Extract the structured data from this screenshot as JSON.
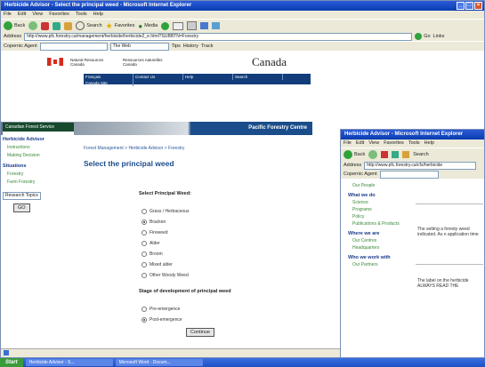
{
  "main_window": {
    "title": "Herbicide Advisor - Select the principal weed - Microsoft Internet Explorer",
    "menu": [
      "File",
      "Edit",
      "View",
      "Favorites",
      "Tools",
      "Help"
    ],
    "toolbar": {
      "back": "Back",
      "search": "Search",
      "favorites": "Favorites",
      "media": "Media"
    },
    "address_label": "Address",
    "address_url": "http://www.pfc.forestry.ca/management/herbicide/herbicide2_e.html?SUBBTN=Forestry",
    "go_label": "Go",
    "links_label": "Links",
    "copernic_label": "Copernic Agent",
    "copernic_search": "The Web",
    "copernic_buttons": [
      "Tips",
      "History",
      "Track"
    ],
    "status_text": ""
  },
  "page": {
    "gov_left_en": "Natural Resources Canada",
    "gov_left_fr": "Ressources naturelles Canada",
    "wordmark": "Canada",
    "nav_cells": [
      "Français",
      "Contact Us",
      "Help",
      "Search",
      "Canada Site",
      "CFS Home",
      "PFC Home",
      "What's New",
      "Links",
      "NRCan Home"
    ],
    "banner_text": "Pacific Forestry Centre",
    "left_nav_header": "Canadian Forest Service",
    "left_nav_title": "Herbicide Advisor",
    "left_nav_items": [
      "Instructions",
      "Making Decision"
    ],
    "left_nav_section": "Situations",
    "left_nav_items2": [
      "Forestry",
      "Farm Forestry"
    ],
    "research_select": "Research Topics",
    "go_button": "GO",
    "breadcrumb": "Forest Management > Herbicide Advisor > Forestry",
    "heading": "Select the principal weed",
    "form_label1": "Select Principal Weed:",
    "weeds": [
      {
        "label": "Grass / Herbaceous",
        "checked": false
      },
      {
        "label": "Bracken",
        "checked": true
      },
      {
        "label": "Fireweed",
        "checked": false
      },
      {
        "label": "Alder",
        "checked": false
      },
      {
        "label": "Broom",
        "checked": false
      },
      {
        "label": "Mixed alder",
        "checked": false
      },
      {
        "label": "Other Woody Weed",
        "checked": false
      }
    ],
    "form_label2": "Stage of development of principal weed",
    "stages": [
      {
        "label": "Pre-emergence",
        "checked": false
      },
      {
        "label": "Post-emergence",
        "checked": true
      }
    ],
    "continue_button": "Continue"
  },
  "second_window": {
    "title": "Herbicide Advisor - Microsoft Internet Explorer",
    "menu": [
      "File",
      "Edit",
      "View",
      "Favorites",
      "Tools",
      "Help"
    ],
    "back_label": "Back",
    "search_label": "Search",
    "address_label": "Address",
    "address_url": "http://www.pfc.forestry.ca/cfs/herbicide",
    "copernic_label": "Copernic Agent",
    "nav_top": "Our People",
    "section1": "What we do",
    "items1": [
      "Science",
      "Programs",
      "Policy",
      "Publications & Products"
    ],
    "section2": "Where we are",
    "items2": [
      "Our Centres",
      "Headquarters"
    ],
    "section3": "Who we work with",
    "items3": [
      "Our Partners"
    ],
    "text1": "The setting a foresty weed indicated. As n application time",
    "text2": "The label on the herbicide ALWAYS READ THE"
  },
  "taskbar": {
    "start": "Start",
    "tasks": [
      "Herbicide Advisor - S...",
      "Microsoft Word - Docum..."
    ]
  }
}
